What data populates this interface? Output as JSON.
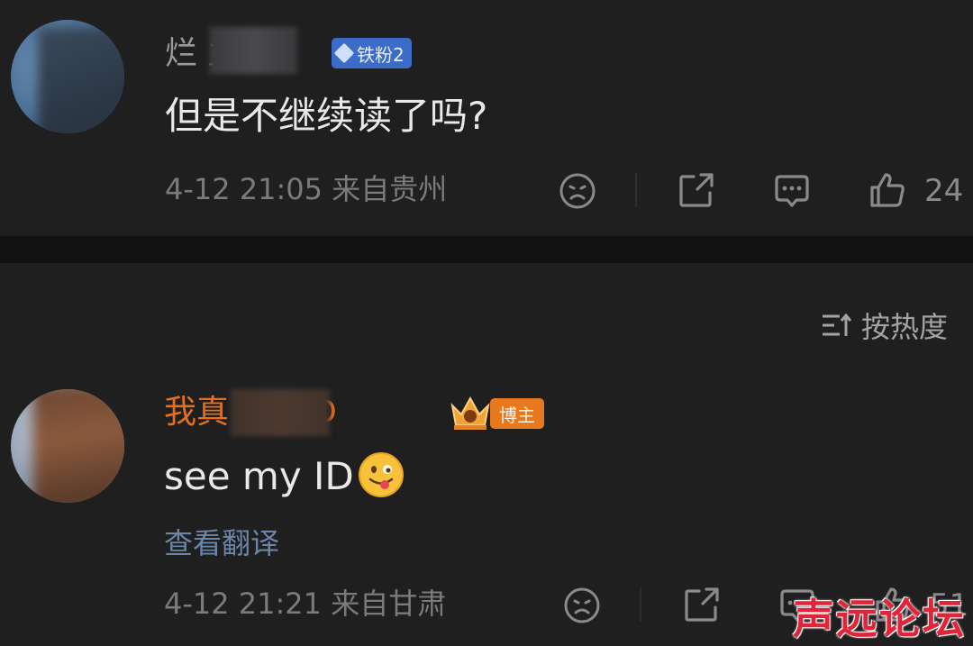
{
  "comments": [
    {
      "username": "烂   兰",
      "badge": "铁粉2",
      "text": "但是不继续读了吗?",
      "meta": "4-12 21:05  来自贵州",
      "likes": "24"
    },
    {
      "username": "我真       卖PhD",
      "badge": "博主",
      "text": "see my ID",
      "translate": "查看翻译",
      "meta": "4-12 21:21  来自甘肃",
      "likes": "51"
    }
  ],
  "sort": {
    "label": "按热度"
  },
  "watermark": "声远论坛",
  "colors": {
    "background": "#1f1f20",
    "blogger_name": "#e2701e",
    "fan_badge": "#3b6cc7",
    "blogger_badge": "#e8781e",
    "translate_link": "#6b86a8"
  }
}
